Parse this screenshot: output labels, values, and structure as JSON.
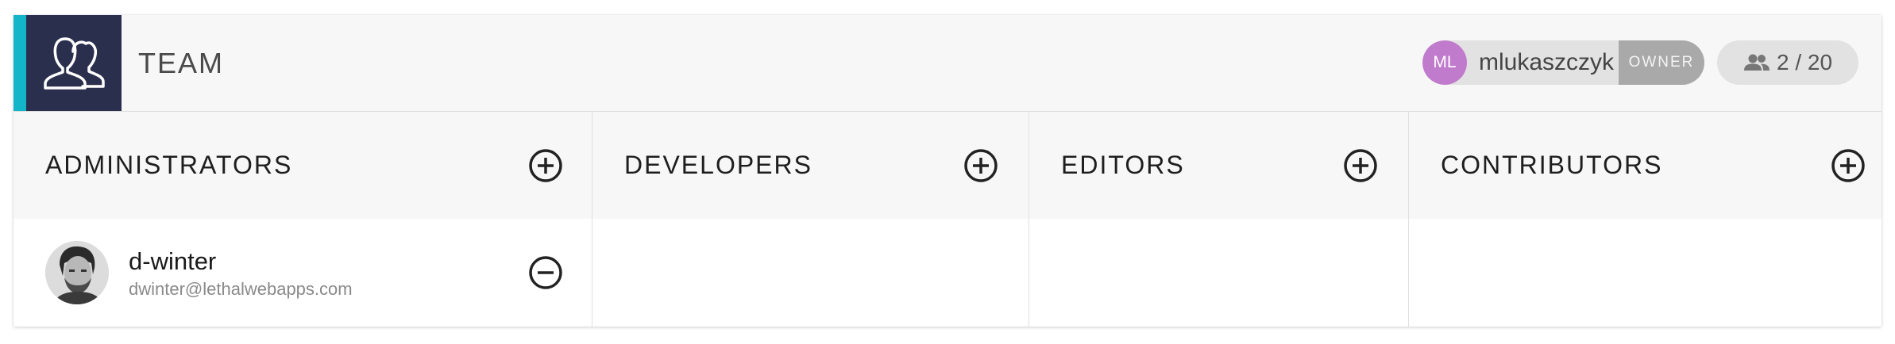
{
  "team": {
    "title": "TEAM",
    "icon": "team-icon",
    "accent_color": "#13b6c9",
    "logo_bg": "#2b2f4e"
  },
  "owner": {
    "initials": "ML",
    "username": "mlukaszczyk",
    "badge": "OWNER",
    "avatar_color": "#c17bcd"
  },
  "member_count": {
    "icon": "people-icon",
    "label": "2 / 20"
  },
  "roles": [
    {
      "title": "ADMINISTRATORS",
      "add_icon": "add-circle-icon",
      "members": [
        {
          "name": "d-winter",
          "email": "dwinter@lethalwebapps.com",
          "remove_icon": "remove-circle-icon"
        }
      ]
    },
    {
      "title": "DEVELOPERS",
      "add_icon": "add-circle-icon",
      "members": []
    },
    {
      "title": "EDITORS",
      "add_icon": "add-circle-icon",
      "members": []
    },
    {
      "title": "CONTRIBUTORS",
      "add_icon": "add-circle-icon",
      "members": []
    }
  ]
}
